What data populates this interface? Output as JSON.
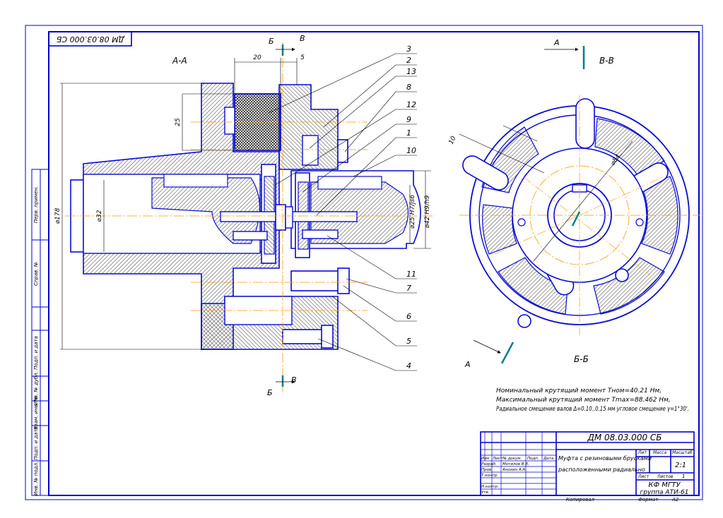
{
  "drawing": {
    "designation": "ДМ 08.03.000 СБ",
    "corner_designation": "ДМ 08.03.000 СБ",
    "title": "Муфта с резиновыми брусками расположенными радиально",
    "title_line1": "Муфта с резиновыми брусками",
    "title_line2": "расположенными радиально",
    "scale": "2:1",
    "sheets_label": "1",
    "organization": "КФ МГТУ",
    "group": "группа АТИ-61",
    "copied_label": "Копировал",
    "format_label": "Формат",
    "format_value": "A2"
  },
  "title_block": {
    "headers": {
      "izm": "Изм",
      "list": "Лист",
      "doc": "№ докум.",
      "sign": "Подп.",
      "date": "Дата",
      "lit": "Лит",
      "mass": "Масса",
      "scale": "Масштаб",
      "sheet": "Лист",
      "sheets": "Листов"
    },
    "rows": [
      {
        "role": "Разраб.",
        "name": "Мотилов В.В."
      },
      {
        "role": "Пров.",
        "name": "Анохин А.А."
      },
      {
        "role": "Т.контр.",
        "name": ""
      },
      {
        "role": "",
        "name": ""
      },
      {
        "role": "Н.контр.",
        "name": ""
      },
      {
        "role": "Утв.",
        "name": ""
      }
    ]
  },
  "side_stamp": [
    "Перв. примен.",
    "Справ. №",
    "Подп. и дата",
    "Инв. № дубл.",
    "Взам. инв. №",
    "Подп. и дата",
    "Инв. № подл."
  ],
  "views": {
    "section_aa": "А-А",
    "section_bb_label": "В-В",
    "section_bb_bottom": "Б-Б",
    "arrow_a": "А",
    "arrow_b": "Б",
    "arrow_v": "В"
  },
  "dimensions": {
    "d178": "⌀178",
    "d32": "⌀32",
    "d25": "⌀25 H7/js6",
    "d42": "⌀42 H9/h9",
    "d84": "⌀84",
    "w20": "20",
    "w5": "5",
    "h25": "25",
    "w10": "10"
  },
  "callouts": [
    "3",
    "2",
    "13",
    "8",
    "12",
    "9",
    "1",
    "10",
    "11",
    "7",
    "6",
    "5",
    "4"
  ],
  "notes": [
    "Номинальный крутящий момент Tном=40.21 Нм,",
    "Максимальный крутящий момент Tmax=88.462 Нм,",
    "Радиальное смещение валов Δ=0.10..0.15 мм угловое смещение γ=1°30'."
  ],
  "colors": {
    "frame": "#0000cc",
    "line": "#0a0ad2",
    "hatch": "#1a1a1a",
    "center": "#ff9900",
    "callout": "#000000",
    "teal": "#008080"
  }
}
